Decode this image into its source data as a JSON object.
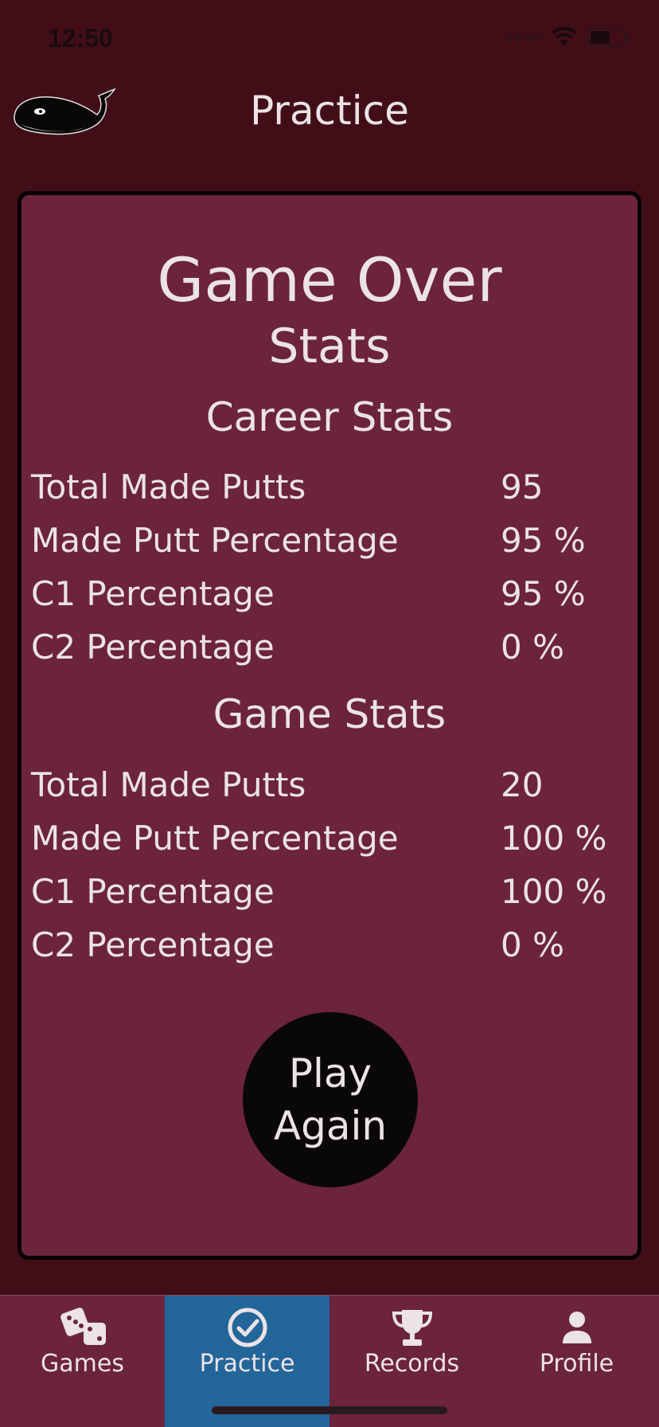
{
  "status_bar": {
    "time": "12:50"
  },
  "nav": {
    "title": "Practice",
    "logo_icon": "whale-logo-icon"
  },
  "game_over": {
    "title": "Game Over",
    "subtitle": "Stats",
    "career": {
      "heading": "Career Stats",
      "rows": [
        {
          "label": "Total Made Putts",
          "value": "95"
        },
        {
          "label": "Made Putt Percentage",
          "value": "95 %"
        },
        {
          "label": "C1 Percentage",
          "value": "95 %"
        },
        {
          "label": "C2 Percentage",
          "value": "0 %"
        }
      ]
    },
    "game": {
      "heading": "Game Stats",
      "rows": [
        {
          "label": "Total Made Putts",
          "value": "20"
        },
        {
          "label": "Made Putt Percentage",
          "value": "100 %"
        },
        {
          "label": "C1 Percentage",
          "value": "100 %"
        },
        {
          "label": "C2 Percentage",
          "value": "0 %"
        }
      ]
    },
    "play_again": {
      "line1": "Play",
      "line2": "Again"
    }
  },
  "tabs": [
    {
      "label": "Games",
      "icon": "dice-icon",
      "active": false
    },
    {
      "label": "Practice",
      "icon": "check-circle-icon",
      "active": true
    },
    {
      "label": "Records",
      "icon": "trophy-icon",
      "active": false
    },
    {
      "label": "Profile",
      "icon": "person-icon",
      "active": false
    }
  ],
  "colors": {
    "background": "#410e18",
    "panel": "#6c233c",
    "tab_bar": "#6c233c",
    "active_tab": "#23669a",
    "button": "#0a0807",
    "text": "#ebe3e6"
  }
}
